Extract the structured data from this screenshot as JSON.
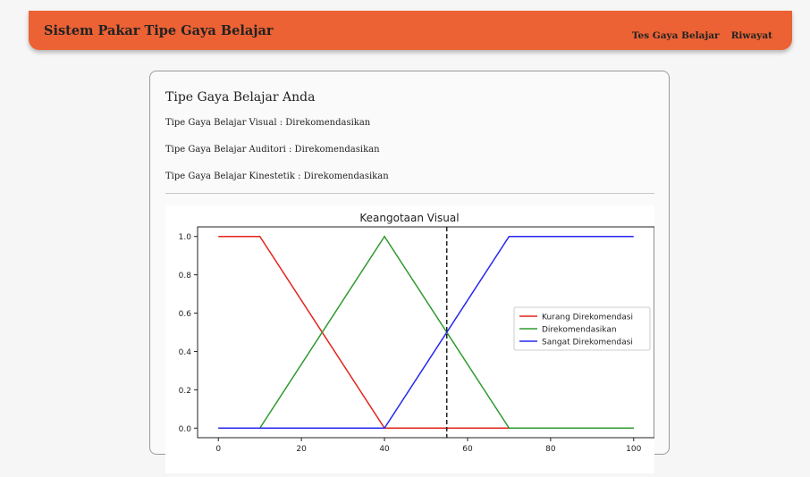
{
  "navbar": {
    "brand": "Sistem Pakar Tipe Gaya Belajar",
    "links": [
      "Tes Gaya Belajar",
      "Riwayat"
    ]
  },
  "result": {
    "title": "Tipe Gaya Belajar Anda",
    "lines": [
      "Tipe Gaya Belajar Visual : Direkomendasikan",
      "Tipe Gaya Belajar Auditori : Direkomendasikan",
      "Tipe Gaya Belajar Kinestetik : Direkomendasikan"
    ]
  },
  "colors": {
    "accent": "#ec6234",
    "kurang": "#e3241b",
    "direkomendasikan": "#2e9a2e",
    "sangat": "#2626f0"
  },
  "chart_data": {
    "type": "line",
    "title": "Keangotaan Visual",
    "xlim": [
      -5,
      105
    ],
    "ylim": [
      -0.05,
      1.05
    ],
    "xticks": [
      0,
      20,
      40,
      60,
      80,
      100
    ],
    "yticks": [
      "0.0",
      "0.2",
      "0.4",
      "0.6",
      "0.8",
      "1.0"
    ],
    "series": [
      {
        "name": "Kurang Direkomendasi",
        "color": "#e3241b",
        "x": [
          0,
          10,
          40,
          100
        ],
        "y": [
          1,
          1,
          0,
          0
        ]
      },
      {
        "name": "Direkomendasikan",
        "color": "#2e9a2e",
        "x": [
          0,
          10,
          40,
          70,
          100
        ],
        "y": [
          0,
          0,
          1,
          0,
          0
        ]
      },
      {
        "name": "Sangat Direkomendasi",
        "color": "#2626f0",
        "x": [
          0,
          40,
          70,
          100
        ],
        "y": [
          0,
          0,
          1,
          1
        ]
      }
    ],
    "vline": 55,
    "legend": "center-right"
  }
}
